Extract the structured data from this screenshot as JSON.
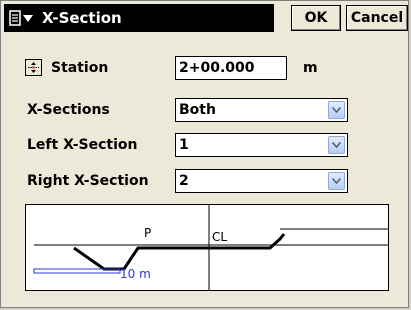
{
  "title_bar": {
    "title": "X-Section",
    "ok_label": "OK",
    "cancel_label": "Cancel"
  },
  "form": {
    "station_label": "Station",
    "station_value": "2+00.000",
    "station_unit": "m",
    "xsections_label": "X-Sections",
    "xsections_value": "Both",
    "left_label": "Left X-Section",
    "left_value": "1",
    "right_label": "Right X-Section",
    "right_value": "2"
  },
  "graph": {
    "point_label": "P",
    "centerline_label": "CL",
    "scale_label": "10 m",
    "scale_color": "#2b3bd4"
  }
}
